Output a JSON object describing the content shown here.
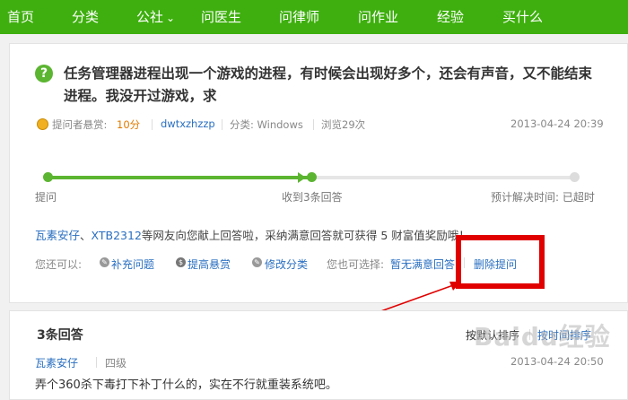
{
  "nav": {
    "items": [
      {
        "label": "首页"
      },
      {
        "label": "分类"
      },
      {
        "label": "公社",
        "caret": "⌄"
      },
      {
        "label": "问医生"
      },
      {
        "label": "问律师"
      },
      {
        "label": "问作业"
      },
      {
        "label": "经验"
      },
      {
        "label": "买什么"
      }
    ]
  },
  "question": {
    "icon": "?",
    "title": "任务管理器进程出现一个游戏的进程，有时候会出现好多个，还会有声音，又不能结束进程。我没开过游戏，求",
    "reward_label": "提问者悬赏:",
    "reward_value": "10分",
    "asker": "dwtxzhzzp",
    "category": "分类: Windows",
    "views": "浏览29次",
    "time": "2013-04-24 20:39"
  },
  "progress": {
    "steps": [
      "提问",
      "收到3条回答",
      "预计解决时间: 已超时"
    ]
  },
  "thanks": {
    "user1": "瓦素安仔",
    "sep": "、",
    "user2": "XTB2312",
    "text": "等网友向您献上回答啦，采纳满意回答就可获得 5 财富值奖励哦！"
  },
  "options": {
    "you_can": "您还可以:",
    "supplement": "补充问题",
    "raise_reward": "提高悬赏",
    "edit_category": "修改分类",
    "you_may_choose": "您也可选择:",
    "no_satisfying": "暂无满意回答",
    "delete": "删除提问"
  },
  "answers": {
    "header": "3条回答",
    "sort_default": "按默认排序",
    "sort_time": "按时间排序",
    "first": {
      "user": "瓦素安仔",
      "level": "四级",
      "time": "2013-04-24 20:50",
      "text": "弄个360杀下毒打下补丁什么的，实在不行就重装系统吧。"
    }
  },
  "watermark": "Baidu经验",
  "colors": {
    "nav": "#3eaf0e",
    "accent": "#5cb531",
    "link": "#2a6fc0",
    "reward": "#e07b00",
    "highlight": "#e00000"
  }
}
